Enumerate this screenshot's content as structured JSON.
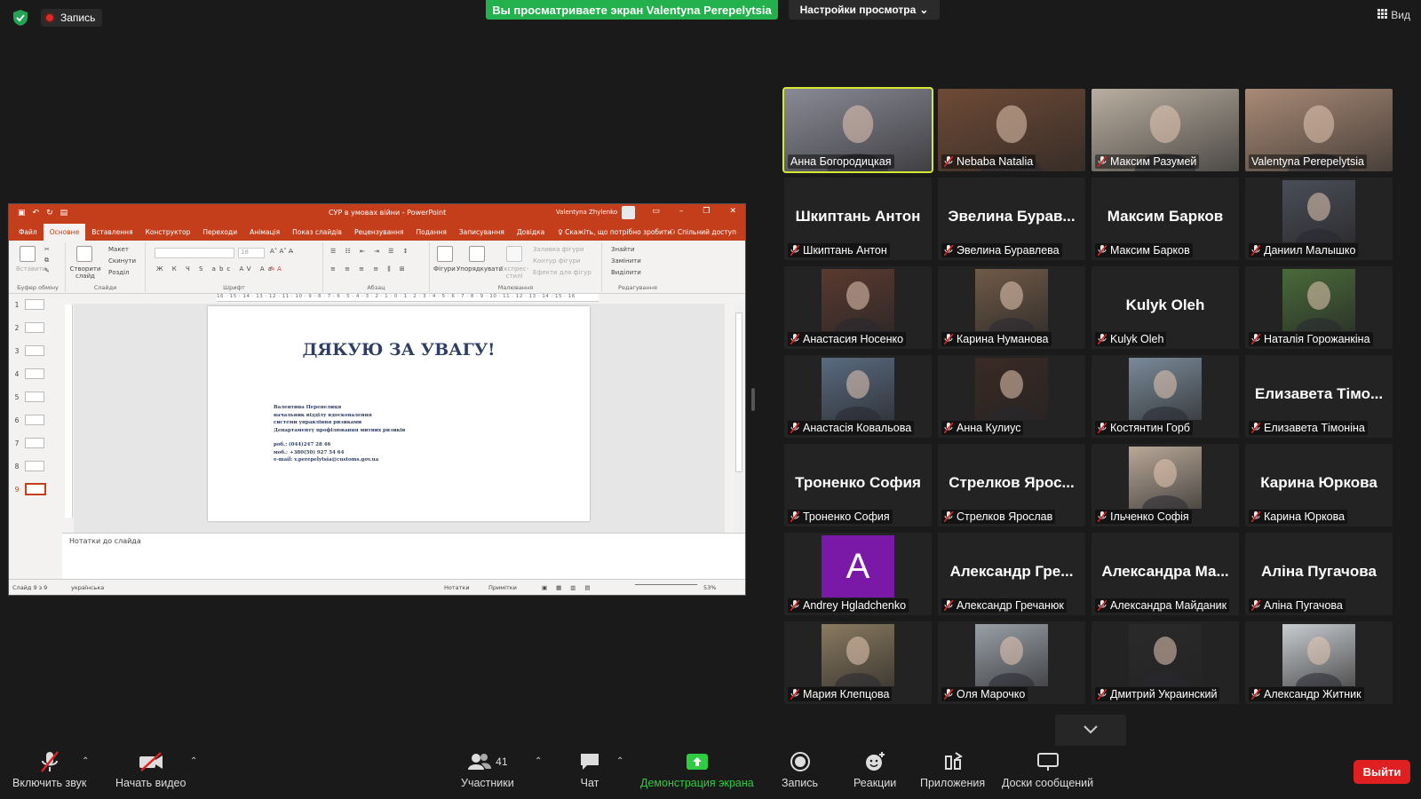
{
  "top": {
    "record_label": "Запись",
    "share_banner": "Вы просматриваете экран Valentynа Perepelytsia",
    "view_options": "Настройки просмотра",
    "view_label": "Вид"
  },
  "ppt": {
    "doc_title": "СУР в умовах війни  -  PowerPoint",
    "user": "Valentyna Zhylenko",
    "tabs": [
      "Файл",
      "Основне",
      "Вставлення",
      "Конструктор",
      "Переходи",
      "Анімація",
      "Показ слайдів",
      "Рецензування",
      "Подання",
      "Записування",
      "Довідка"
    ],
    "tell_me": "Скажіть, що потрібно зробити",
    "share": "Спільний доступ",
    "groups": {
      "clipboard": "Буфер обміну",
      "slides": "Слайди",
      "font": "Шрифт",
      "paragraph": "Абзац",
      "drawing": "Малювання",
      "editing": "Редагування"
    },
    "ribbon_items": {
      "paste": "Вставити",
      "new_slide": "Створити слайд",
      "layout": "Макет",
      "reset": "Скинути",
      "section": "Розділ",
      "font_size": "18",
      "shapes": "Фігури",
      "arrange": "Упорядкувати",
      "quick_styles": "Експрес-стилі",
      "fill": "Заливка фігури",
      "outline": "Контур фігури",
      "effects": "Ефекти для фігур",
      "find": "Знайти",
      "replace": "Замінити",
      "select": "Виділити"
    },
    "ruler_text": "16 · 15 · 14 · 13 · 12 · 11 · 10 · 9 · 8 · 7 · 6 · 5 · 4 · 3 · 2 · 1 · 0 · 1 · 2 · 3 · 4 · 5 · 6 · 7 · 8 · 9 · 10 · 11 · 12 · 13 · 14 · 15 · 16",
    "thumb_numbers": [
      "1",
      "2",
      "3",
      "4",
      "5",
      "6",
      "7",
      "8",
      "9"
    ],
    "slide_title": "ДЯКУЮ ЗА УВАГУ!",
    "slide_lines": [
      "Валентина Перепелиця",
      "начальник відділу вдосконалення",
      "системи управління ризиками",
      "Департаменту профілювання митних ризиків"
    ],
    "slide_contacts": [
      "роб.: (044)247 28 46",
      "моб.: +380(50) 927 54 64",
      "e-mail: v.perepelytsia@customs.gov.ua"
    ],
    "notes_placeholder": "Нотатки до слайда",
    "status": {
      "slide_of": "Слайд 9 з 9",
      "language": "українська",
      "notes": "Нотатки",
      "comments": "Примітки",
      "zoom": "53%"
    }
  },
  "participants": [
    {
      "name": "Анна Богородицкая",
      "muted": false,
      "kind": "photo",
      "active": true,
      "bg": "#8a8a96"
    },
    {
      "name": "Nebaba Natalia",
      "muted": true,
      "kind": "photo",
      "bg": "#6e4a36"
    },
    {
      "name": "Максим Разумей",
      "muted": true,
      "kind": "photo",
      "bg": "#b9aea0"
    },
    {
      "name": "Valentyna Perepelytsia",
      "muted": false,
      "kind": "photo",
      "bg": "#a98a76"
    },
    {
      "name": "Шкиптань Антон",
      "muted": true,
      "kind": "name",
      "big": "Шкиптань Антон"
    },
    {
      "name": "Эвелина Буравлева",
      "muted": true,
      "kind": "name",
      "big": "Эвелина Бурав..."
    },
    {
      "name": "Максим Барков",
      "muted": true,
      "kind": "name",
      "big": "Максим Барков"
    },
    {
      "name": "Даниил Малышко",
      "muted": true,
      "kind": "photo",
      "bg": "#4a4e58"
    },
    {
      "name": "Анастасия Носенко",
      "muted": true,
      "kind": "photo",
      "bg": "#5a3a30"
    },
    {
      "name": "Карина Нуманова",
      "muted": true,
      "kind": "photo",
      "bg": "#705a48"
    },
    {
      "name": "Kulyk Oleh",
      "muted": true,
      "kind": "name",
      "big": "Kulyk Oleh"
    },
    {
      "name": "Наталія Горожанкіна",
      "muted": true,
      "kind": "photo",
      "bg": "#4a6a3a"
    },
    {
      "name": "Анастасія Ковальова",
      "muted": true,
      "kind": "photo",
      "bg": "#5a6a80"
    },
    {
      "name": "Анна Кулиус",
      "muted": true,
      "kind": "photo",
      "bg": "#3a2a24"
    },
    {
      "name": "Костянтин Горб",
      "muted": true,
      "kind": "photo",
      "bg": "#7a8a98"
    },
    {
      "name": "Елизавета Тімоніна",
      "muted": true,
      "kind": "name",
      "big": "Елизавета Тімо..."
    },
    {
      "name": "Троненко София",
      "muted": true,
      "kind": "name",
      "big": "Троненко София"
    },
    {
      "name": "Стрелков Ярослав",
      "muted": true,
      "kind": "name",
      "big": "Стрелков Ярос..."
    },
    {
      "name": "Ільченко Софія",
      "muted": true,
      "kind": "photo",
      "bg": "#b8a898"
    },
    {
      "name": "Карина Юркова",
      "muted": true,
      "kind": "name",
      "big": "Карина Юркова"
    },
    {
      "name": "Andrey Hgladchenko",
      "muted": true,
      "kind": "letter",
      "big": "A"
    },
    {
      "name": "Александр Гречанюк",
      "muted": true,
      "kind": "name",
      "big": "Александр Гре..."
    },
    {
      "name": "Александра Майданик",
      "muted": true,
      "kind": "name",
      "big": "Александра Ма..."
    },
    {
      "name": "Аліна Пугачова",
      "muted": true,
      "kind": "name",
      "big": "Аліна Пугачова"
    },
    {
      "name": "Мария Клепцова",
      "muted": true,
      "kind": "photo",
      "bg": "#8a7a60"
    },
    {
      "name": "Оля Марочко",
      "muted": true,
      "kind": "photo",
      "bg": "#9aa0a8"
    },
    {
      "name": "Дмитрий Украинский",
      "muted": true,
      "kind": "photo",
      "bg": "#2a2a2a"
    },
    {
      "name": "Александр Житник",
      "muted": true,
      "kind": "photo",
      "bg": "#c8ccd0"
    }
  ],
  "toolbar": {
    "unmute": "Включить звук",
    "start_video": "Начать видео",
    "participants": "Участники",
    "participants_count": "41",
    "chat": "Чат",
    "share_screen": "Демонстрация экрана",
    "record": "Запись",
    "reactions": "Реакции",
    "apps": "Приложения",
    "whiteboards": "Доски сообщений",
    "leave": "Выйти"
  },
  "colors": {
    "share_green": "#22b14c",
    "ppt_red": "#c43e1c",
    "active_speaker": "#d5e834",
    "leave_red": "#e02020",
    "avatar_purple": "#7a18a8"
  }
}
